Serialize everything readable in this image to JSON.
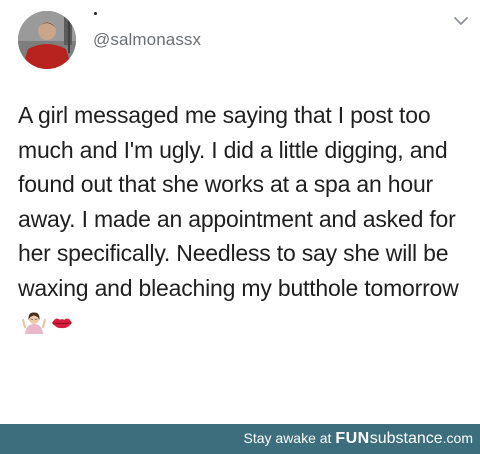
{
  "post": {
    "handle": "@salmonassx",
    "body": "A girl messaged me saying that I post too much and I'm ugly. I did a little digging, and found out that she works at a spa an hour away. I made an appointment and asked for her specifically. Needless to say she will be waxing and bleaching my butthole tomorrow",
    "emojis": [
      "woman-shrugging-emoji",
      "kiss-mark-emoji"
    ]
  },
  "footer": {
    "prefix": "Stay awake at ",
    "brand_bold": "FUN",
    "brand_rest": "substance",
    "domain": ".com"
  },
  "colors": {
    "footer_bg": "#3c6e7d",
    "handle": "#6b6f73",
    "text": "#1f1f1f"
  }
}
